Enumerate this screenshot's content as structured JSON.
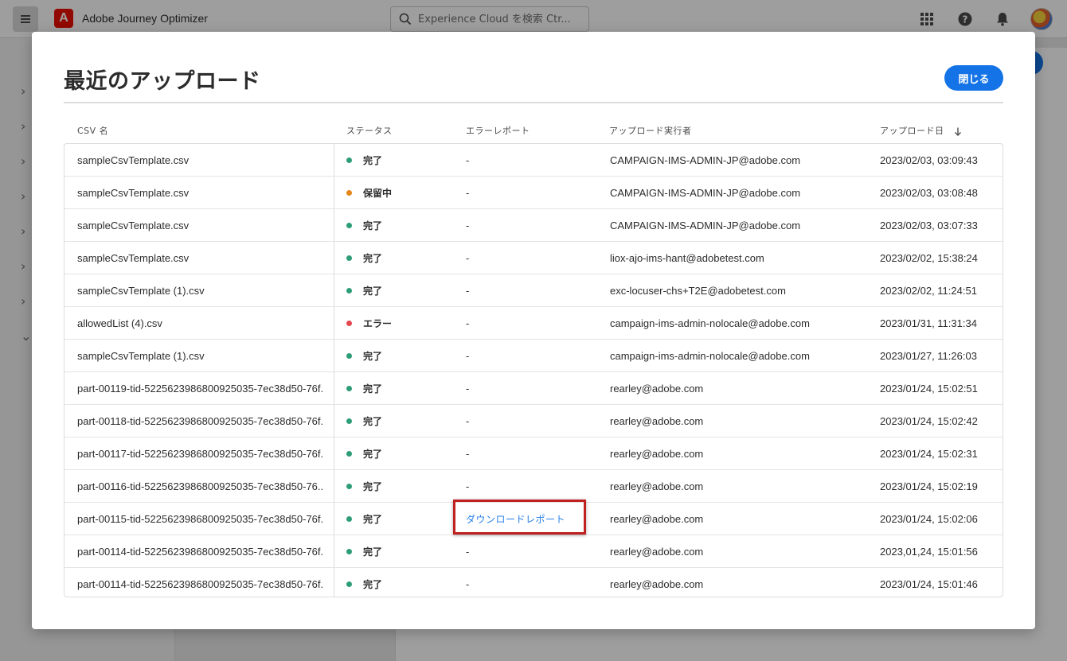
{
  "app": {
    "title": "Adobe Journey Optimizer",
    "logo_letter": "A",
    "search_placeholder": "Experience Cloud を検索 Ctr...",
    "brand_color": "#eb1000"
  },
  "modal": {
    "title": "最近のアップロード",
    "close_label": "閉じる",
    "accent_color": "#1473e6"
  },
  "table": {
    "headers": {
      "csv_name": "CSV 名",
      "status": "ステータス",
      "error_report": "エラーレポート",
      "uploader": "アップロード実行者",
      "upload_date": "アップロード日"
    },
    "sort": {
      "column": "upload_date",
      "direction": "descending",
      "icon": "arrow-down-icon"
    },
    "status_colors": {
      "done": "#2d9d78",
      "pending": "#e68619",
      "error": "#e34850"
    },
    "rows": [
      {
        "name": "sampleCsvTemplate.csv",
        "status": "完了",
        "status_key": "done",
        "error": "-",
        "user": "CAMPAIGN-IMS-ADMIN-JP@adobe.com",
        "date": "2023/02/03, 03:09:43"
      },
      {
        "name": "sampleCsvTemplate.csv",
        "status": "保留中",
        "status_key": "pending",
        "error": "-",
        "user": "CAMPAIGN-IMS-ADMIN-JP@adobe.com",
        "date": "2023/02/03, 03:08:48"
      },
      {
        "name": "sampleCsvTemplate.csv",
        "status": "完了",
        "status_key": "done",
        "error": "-",
        "user": "CAMPAIGN-IMS-ADMIN-JP@adobe.com",
        "date": "2023/02/03, 03:07:33"
      },
      {
        "name": "sampleCsvTemplate.csv",
        "status": "完了",
        "status_key": "done",
        "error": "-",
        "user": "liox-ajo-ims-hant@adobetest.com",
        "date": "2023/02/02, 15:38:24"
      },
      {
        "name": "sampleCsvTemplate (1).csv",
        "status": "完了",
        "status_key": "done",
        "error": "-",
        "user": "exc-locuser-chs+T2E@adobetest.com",
        "date": "2023/02/02, 11:24:51"
      },
      {
        "name": "allowedList (4).csv",
        "status": "エラー",
        "status_key": "error",
        "error": "-",
        "user": "campaign-ims-admin-nolocale@adobe.com",
        "date": "2023/01/31, 11:31:34"
      },
      {
        "name": "sampleCsvTemplate (1).csv",
        "status": "完了",
        "status_key": "done",
        "error": "-",
        "user": "campaign-ims-admin-nolocale@adobe.com",
        "date": "2023/01/27, 11:26:03"
      },
      {
        "name": "part-00119-tid-5225623986800925035-7ec38d50-76f...",
        "status": "完了",
        "status_key": "done",
        "error": "-",
        "user": "rearley@adobe.com",
        "date": "2023/01/24, 15:02:51"
      },
      {
        "name": "part-00118-tid-5225623986800925035-7ec38d50-76f...",
        "status": "完了",
        "status_key": "done",
        "error": "-",
        "user": "rearley@adobe.com",
        "date": "2023/01/24, 15:02:42"
      },
      {
        "name": "part-00117-tid-5225623986800925035-7ec38d50-76f...",
        "status": "完了",
        "status_key": "done",
        "error": "-",
        "user": "rearley@adobe.com",
        "date": "2023/01/24, 15:02:31"
      },
      {
        "name": "part-00116-tid-5225623986800925035-7ec38d50-76...",
        "status": "完了",
        "status_key": "done",
        "error": "-",
        "user": "rearley@adobe.com",
        "date": "2023/01/24, 15:02:19"
      },
      {
        "name": "part-00115-tid-5225623986800925035-7ec38d50-76f...",
        "status": "完了",
        "status_key": "done",
        "error": "ダウンロードレポート",
        "error_is_link": true,
        "user": "rearley@adobe.com",
        "date": "2023/01/24, 15:02:06"
      },
      {
        "name": "part-00114-tid-5225623986800925035-7ec38d50-76f...",
        "status": "完了",
        "status_key": "done",
        "error": "-",
        "user": "rearley@adobe.com",
        "date": "2023,01,24, 15:01:56"
      },
      {
        "name": "part-00114-tid-5225623986800925035-7ec38d50-76f...",
        "status": "完了",
        "status_key": "done",
        "error": "-",
        "user": "rearley@adobe.com",
        "date": "2023/01/24, 15:01:46"
      }
    ]
  }
}
